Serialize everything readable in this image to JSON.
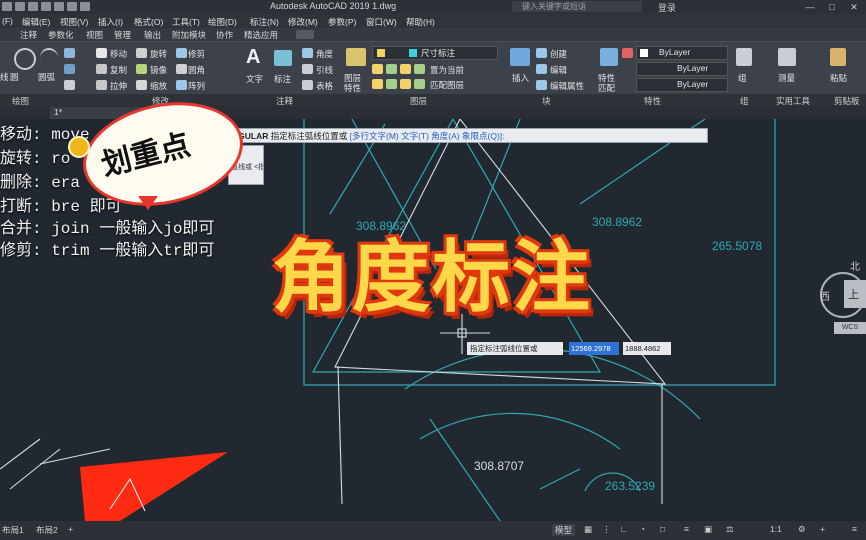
{
  "app": {
    "title": "Autodesk AutoCAD 2019    1.dwg",
    "search_placeholder": "键入关键字或短语",
    "login": "登录",
    "window_controls": [
      "minimize-icon",
      "maximize-icon",
      "close-icon"
    ]
  },
  "menu": [
    "(F)",
    "编辑(E)",
    "视图(V)",
    "插入(I)",
    "格式(O)",
    "工具(T)",
    "绘图(D)",
    "标注(N)",
    "修改(M)",
    "参数(P)",
    "窗口(W)",
    "帮助(H)"
  ],
  "ribbon_tabs": [
    "注释",
    "参数化",
    "视图",
    "管理",
    "输出",
    "附加模块",
    "协作",
    "精选应用"
  ],
  "ribbon": {
    "modify": [
      "移动",
      "旋转",
      "修剪",
      "复制",
      "镜像",
      "圆角",
      "拉伸",
      "缩放",
      "阵列"
    ],
    "annotation": [
      "文字",
      "标注",
      "角度",
      "引线",
      "表格"
    ],
    "dim_style": "尺寸标注",
    "layer": [
      "图层",
      "特性",
      "置为当前",
      "匹配图层"
    ],
    "block": [
      "插入",
      "创建",
      "编辑",
      "编辑属性"
    ],
    "properties": [
      "特性",
      "匹配",
      "ByLayer",
      "ByLayer",
      "ByLayer"
    ],
    "others": [
      "组",
      "测量",
      "粘贴",
      "圆",
      "圆弧"
    ],
    "left_partial": [
      "线",
      "多段线"
    ]
  },
  "panels": [
    "绘图",
    "修改",
    "注释",
    "图层",
    "块",
    "特性",
    "组",
    "实用工具",
    "剪贴板"
  ],
  "doc_tab": "1*",
  "command_line": {
    "prefix": "NGULAR",
    "text": "指定标注弧线位置或",
    "options": "[多行文字(M) 文字(T) 角度(A) 象限点(Q)]:"
  },
  "left_notes": [
    "移动: move",
    "旋转: ro",
    "删除: era",
    "打断: bre           即可",
    "合并: join  一般输入jo即可",
    "修剪: trim  一般输入tr即可"
  ],
  "sticker": "划重点",
  "headline": "角度标注",
  "dynamic_input": {
    "label": "指定标注弧线位置或",
    "value1": "12569.2978",
    "value2": "1888.4862"
  },
  "dimensions": {
    "d1": "308.8962",
    "d2": "308.8962",
    "d3": "265.5078",
    "d4": "308.8707",
    "d5": "263.5239"
  },
  "popup_items": [
    "直线或 <指定顶点>"
  ],
  "viewcube": {
    "north": "北",
    "west": "西",
    "top": "上",
    "ref": "WCS"
  },
  "layout_tabs": [
    "布局1",
    "布局2"
  ],
  "status": {
    "model": "模型",
    "scale": "1:1"
  },
  "colors": {
    "canvas_bg": "#212830",
    "geometry": "#2fa9b3",
    "highlight": "#ff2a12",
    "title_fill": "#ffd84a",
    "title_stroke": "#e0380f"
  }
}
